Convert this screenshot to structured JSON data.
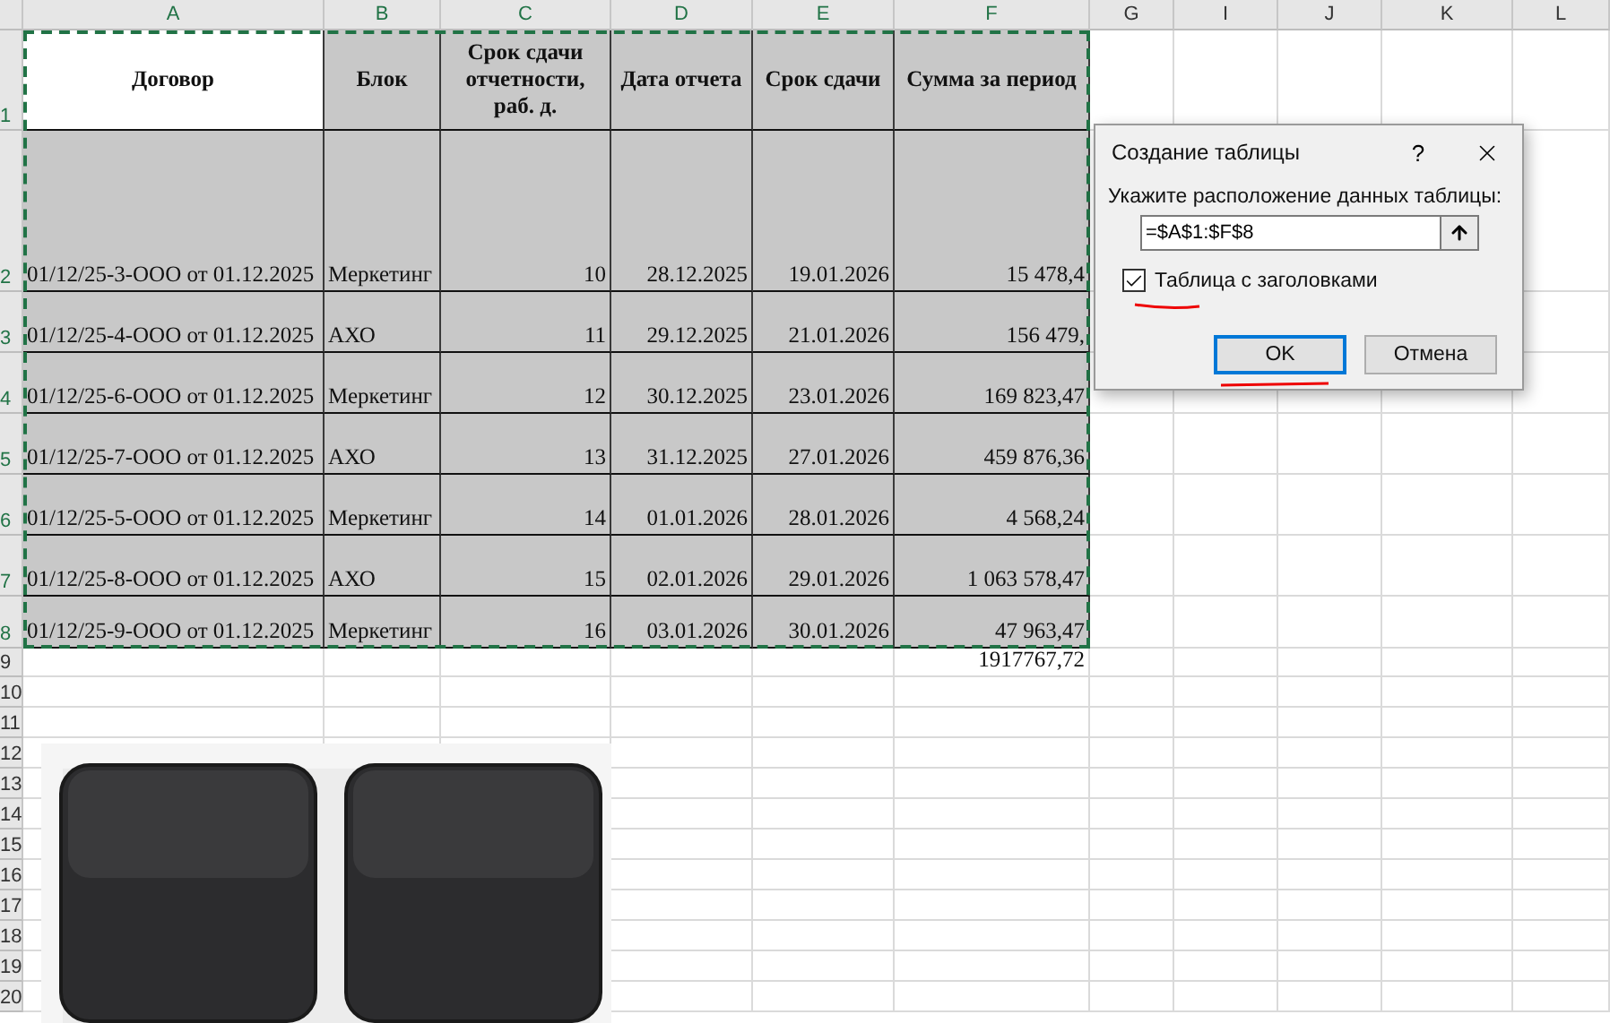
{
  "column_headers": [
    {
      "label": "A",
      "selected": true
    },
    {
      "label": "B",
      "selected": true
    },
    {
      "label": "C",
      "selected": true
    },
    {
      "label": "D",
      "selected": true
    },
    {
      "label": "E",
      "selected": true
    },
    {
      "label": "F",
      "selected": true
    },
    {
      "label": "G",
      "selected": false
    },
    {
      "label": "I",
      "selected": false
    },
    {
      "label": "J",
      "selected": false
    },
    {
      "label": "K",
      "selected": false
    },
    {
      "label": "L",
      "selected": false
    }
  ],
  "row_headers": [
    {
      "label": "1",
      "selected": true
    },
    {
      "label": "2",
      "selected": true
    },
    {
      "label": "3",
      "selected": true
    },
    {
      "label": "4",
      "selected": true
    },
    {
      "label": "5",
      "selected": true
    },
    {
      "label": "6",
      "selected": true
    },
    {
      "label": "7",
      "selected": true
    },
    {
      "label": "8",
      "selected": true
    },
    {
      "label": "9",
      "selected": false
    },
    {
      "label": "10",
      "selected": false
    },
    {
      "label": "11",
      "selected": false
    },
    {
      "label": "12",
      "selected": false
    },
    {
      "label": "13",
      "selected": false
    },
    {
      "label": "14",
      "selected": false
    },
    {
      "label": "15",
      "selected": false
    },
    {
      "label": "16",
      "selected": false
    },
    {
      "label": "17",
      "selected": false
    },
    {
      "label": "18",
      "selected": false
    },
    {
      "label": "19",
      "selected": false
    },
    {
      "label": "20",
      "selected": false
    }
  ],
  "header_row": [
    "Договор",
    "Блок",
    "Срок сдачи отчетности, раб. д.",
    "Дата отчета",
    "Срок сдачи",
    "Сумма за период"
  ],
  "rows": [
    {
      "cells": [
        "01/12/25-3-ООО от 01.12.2025",
        "Меркетинг",
        "10",
        "28.12.2025",
        "19.01.2026",
        "15 478,4"
      ]
    },
    {
      "cells": [
        "01/12/25-4-ООО от 01.12.2025",
        "АХО",
        "11",
        "29.12.2025",
        "21.01.2026",
        "156 479,"
      ]
    },
    {
      "cells": [
        "01/12/25-6-ООО от 01.12.2025",
        "Меркетинг",
        "12",
        "30.12.2025",
        "23.01.2026",
        "169 823,47"
      ]
    },
    {
      "cells": [
        "01/12/25-7-ООО от 01.12.2025",
        "АХО",
        "13",
        "31.12.2025",
        "27.01.2026",
        "459 876,36"
      ]
    },
    {
      "cells": [
        "01/12/25-5-ООО от 01.12.2025",
        "Меркетинг",
        "14",
        "01.01.2026",
        "28.01.2026",
        "4 568,24"
      ]
    },
    {
      "cells": [
        "01/12/25-8-ООО от 01.12.2025",
        "АХО",
        "15",
        "02.01.2026",
        "29.01.2026",
        "1 063 578,47"
      ]
    },
    {
      "cells": [
        "01/12/25-9-ООО от 01.12.2025",
        "Меркетинг",
        "16",
        "03.01.2026",
        "30.01.2026",
        "47 963,47"
      ]
    }
  ],
  "total": "1917767,72",
  "dialog": {
    "title": "Создание таблицы",
    "help": "?",
    "prompt": "Укажите расположение данных таблицы:",
    "range": "=$A$1:$F$8",
    "checkbox": {
      "label": "Таблица с заголовками",
      "checked": true
    },
    "buttons": [
      {
        "label": "OK",
        "default": true
      },
      {
        "label": "Отмена",
        "default": false
      }
    ]
  },
  "inset": {
    "kind": "picture"
  }
}
